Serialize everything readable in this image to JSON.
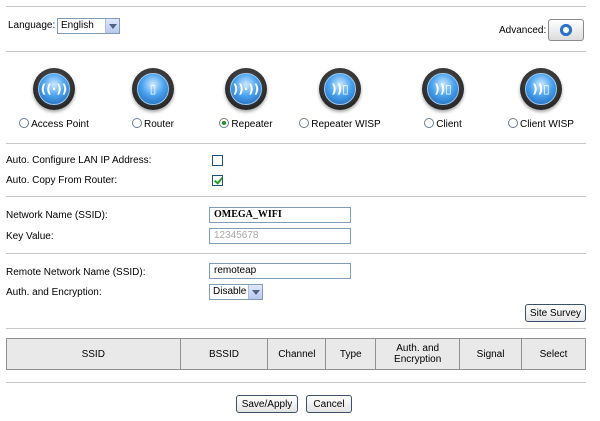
{
  "top": {
    "language_label": "Language:",
    "language_value": "English",
    "advanced_label": "Advanced:"
  },
  "modes": [
    {
      "label": "Access Point",
      "glyph": "((·))",
      "selected": false
    },
    {
      "label": "Router",
      "glyph": "▯",
      "selected": false
    },
    {
      "label": "Repeater",
      "glyph": "))·))",
      "selected": true
    },
    {
      "label": "Repeater WISP",
      "glyph": "))▯",
      "selected": false
    },
    {
      "label": "Client",
      "glyph": "))▯",
      "selected": false
    },
    {
      "label": "Client WISP",
      "glyph": "))▯",
      "selected": false
    }
  ],
  "lan": {
    "auto_config_label": "Auto. Configure LAN IP Address:",
    "auto_config_checked": false,
    "auto_copy_label": "Auto. Copy From Router:",
    "auto_copy_checked": true
  },
  "network": {
    "ssid_label": "Network Name (SSID):",
    "ssid_value": "OMEGA_WIFI",
    "key_label": "Key Value:",
    "key_value": "12345678"
  },
  "remote": {
    "ssid_label": "Remote Network Name (SSID):",
    "ssid_value": "remoteap",
    "auth_label": "Auth. and Encryption:",
    "auth_value": "Disable",
    "site_survey_label": "Site Survey"
  },
  "survey_table": {
    "columns": [
      "SSID",
      "BSSID",
      "Channel",
      "Type",
      "Auth. and Encryption",
      "Signal",
      "Select"
    ]
  },
  "footer": {
    "save_label": "Save/Apply",
    "cancel_label": "Cancel"
  }
}
